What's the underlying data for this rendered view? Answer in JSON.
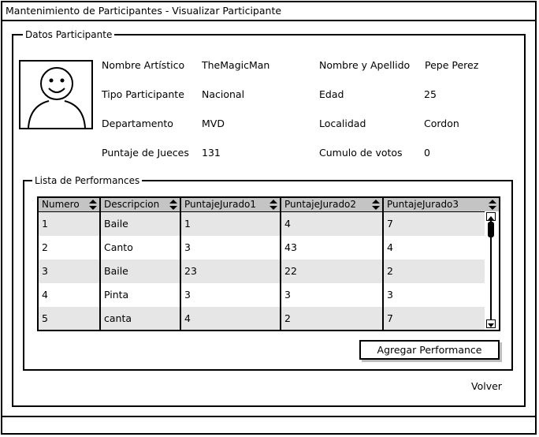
{
  "window": {
    "title": "Mantenimiento de Participantes - Visualizar Participante"
  },
  "datos": {
    "legend": "Datos Participante",
    "fields": [
      {
        "label": "Nombre Artístico",
        "value": "TheMagicMan"
      },
      {
        "label": "Nombre y Apellido",
        "value": "Pepe Perez"
      },
      {
        "label": "Tipo Participante",
        "value": "Nacional"
      },
      {
        "label": "Edad",
        "value": "25"
      },
      {
        "label": "Departamento",
        "value": "MVD"
      },
      {
        "label": "Localidad",
        "value": "Cordon"
      },
      {
        "label": "Puntaje de Jueces",
        "value": "131"
      },
      {
        "label": "Cumulo de votos",
        "value": "0"
      }
    ]
  },
  "performances": {
    "legend": "Lista de Performances",
    "columns": [
      "Numero",
      "Descripcion",
      "PuntajeJurado1",
      "PuntajeJurado2",
      "PuntajeJurado3"
    ],
    "rows": [
      [
        "1",
        "Baile",
        "1",
        "4",
        "7"
      ],
      [
        "2",
        "Canto",
        "3",
        "43",
        "4"
      ],
      [
        "3",
        "Baile",
        "23",
        "22",
        "2"
      ],
      [
        "4",
        "Pinta",
        "3",
        "3",
        "3"
      ],
      [
        "5",
        "canta",
        "4",
        "2",
        "7"
      ]
    ],
    "add_button": "Agregar Performance"
  },
  "footer": {
    "back_link": "Volver"
  },
  "icons": {
    "avatar": "user-avatar-icon",
    "sort": "sort-updown-icon",
    "scroll_up": "arrow-up-icon",
    "scroll_down": "arrow-down-icon"
  }
}
